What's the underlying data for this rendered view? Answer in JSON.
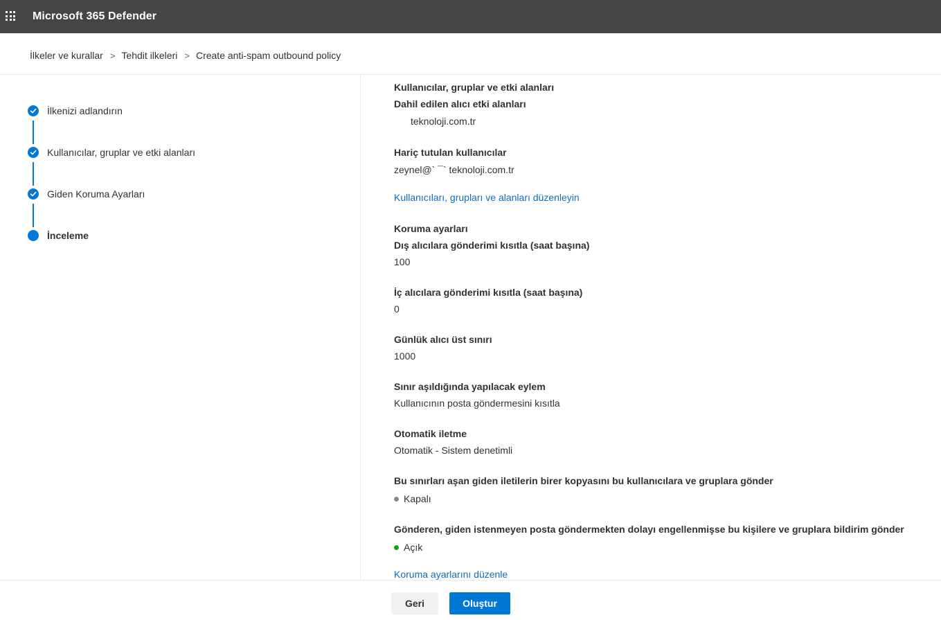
{
  "app": {
    "title": "Microsoft 365 Defender"
  },
  "icons": {
    "app_launcher": "waffle-icon",
    "breadcrumb_separator": "chevron-right-icon",
    "step_done": "checkmark-icon"
  },
  "breadcrumb": {
    "items": [
      "İlkeler ve kurallar",
      "Tehdit ilkeleri",
      "Create anti-spam outbound policy"
    ],
    "separator": ">"
  },
  "wizard": {
    "steps": [
      {
        "label": "İlkenizi adlandırın",
        "status": "completed"
      },
      {
        "label": "Kullanıcılar, gruplar ve etki alanları",
        "status": "completed"
      },
      {
        "label": "Giden Koruma Ayarları",
        "status": "completed"
      },
      {
        "label": "İnceleme",
        "status": "current"
      }
    ]
  },
  "review": {
    "users_section": {
      "title": "Kullanıcılar, gruplar ve etki alanları",
      "included_domains_label": "Dahil edilen alıcı etki alanları",
      "included_domains_value": "teknoloji.com.tr",
      "excluded_users_label": "Hariç tutulan kullanıcılar",
      "excluded_users_value": "zeynel@` ¯` teknoloji.com.tr",
      "edit_link": "Kullanıcıları, grupları ve alanları düzenleyin"
    },
    "protection_section": {
      "title": "Koruma ayarları",
      "external_limit_label": "Dış alıcılara gönderimi kısıtla (saat başına)",
      "external_limit_value": "100",
      "internal_limit_label": "İç alıcılara gönderimi kısıtla (saat başına)",
      "internal_limit_value": "0",
      "daily_limit_label": "Günlük alıcı üst sınırı",
      "daily_limit_value": "1000",
      "action_label": "Sınır aşıldığında yapılacak eylem",
      "action_value": "Kullanıcının posta göndermesini kısıtla",
      "forwarding_label": "Otomatik iletme",
      "forwarding_value": "Otomatik - Sistem denetimli",
      "copy_label": "Bu sınırları aşan giden iletilerin birer kopyasını bu kullanıcılara ve gruplara gönder",
      "copy_value": "Kapalı",
      "copy_status_color": "#8a8886",
      "notify_label": "Gönderen, giden istenmeyen posta göndermekten dolayı engellenmişse bu kişilere ve gruplara bildirim gönder",
      "notify_value": "Açık",
      "notify_status_color": "#13a10e",
      "edit_link": "Koruma ayarlarını düzenle"
    }
  },
  "footer": {
    "back_label": "Geri",
    "create_label": "Oluştur"
  },
  "colors": {
    "header_bg": "#464544",
    "accent": "#0078d4",
    "link": "#0f6cbd"
  }
}
